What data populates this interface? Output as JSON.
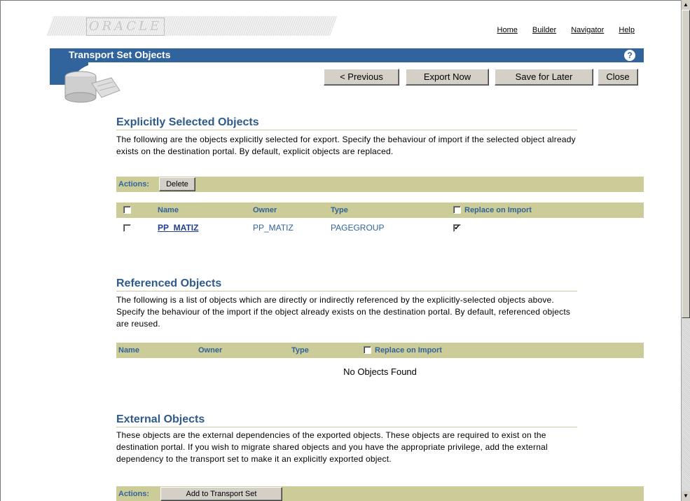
{
  "nav_links": [
    "Home",
    "Builder",
    "Navigator",
    "Help"
  ],
  "logo_text": "ORACLE",
  "page_title": "Transport Set Objects",
  "help_icon_glyph": "?",
  "toolbar": {
    "previous": "< Previous",
    "export_now": "Export Now",
    "save_for_later": "Save for Later",
    "close": "Close"
  },
  "explicit": {
    "heading": "Explicitly Selected Objects",
    "description": "The following are the objects explicitly selected for export. Specify the behaviour of import if the selected object already exists on the destination portal. By default, explicit objects are replaced.",
    "actions_label": "Actions:",
    "delete_label": "Delete",
    "columns": [
      "Name",
      "Owner",
      "Type",
      "Replace on Import"
    ],
    "rows": [
      {
        "name": "PP_MATIZ",
        "owner": "PP_MATIZ",
        "type": "PAGEGROUP",
        "selected": false,
        "replace": true
      }
    ]
  },
  "referenced": {
    "heading": "Referenced Objects",
    "description": "The following is a list of objects which are directly or indirectly referenced by the explicitly-selected objects above. Specify the behaviour of the import if the object already exists on the destination portal. By default, referenced objects are reused.",
    "columns": [
      "Name",
      "Owner",
      "Type",
      "Replace on Import"
    ],
    "empty_message": "No Objects Found"
  },
  "external": {
    "heading": "External Objects",
    "description": "These objects are the external dependencies of the exported objects. These objects are required to exist on the destination portal. If you wish to migrate shared objects and you have the appropriate privilege, add the external dependency to the transport set to make it an explicitly exported object.",
    "actions_label": "Actions:",
    "add_label": "Add to Transport Set"
  },
  "colors": {
    "title_bar": "#31639c",
    "table_header": "#cccc99",
    "heading_text": "#2e5a8c"
  }
}
